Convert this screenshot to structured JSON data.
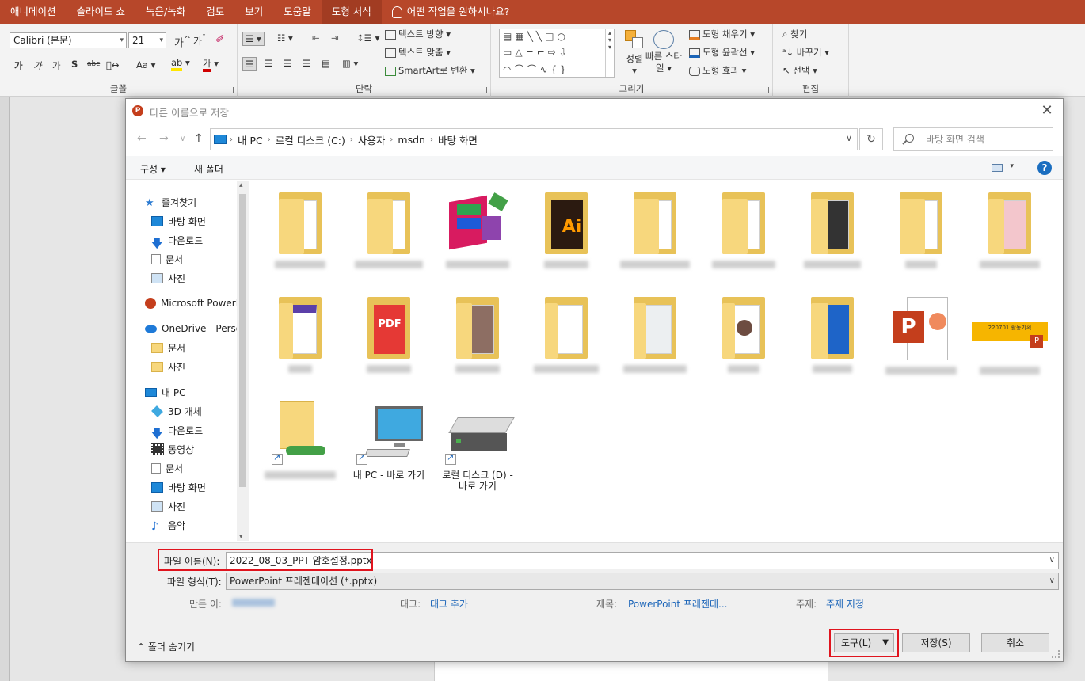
{
  "ribbon_tabs": [
    "애니메이션",
    "슬라이드 쇼",
    "녹음/녹화",
    "검토",
    "보기",
    "도움말",
    "도형 서식"
  ],
  "tell_me": "어떤 작업을 원하시나요?",
  "font": {
    "name": "Calibri (본문)",
    "size": "21",
    "group_label": "글꼴"
  },
  "paragraph": {
    "text_direction": "텍스트 방향",
    "align_text": "텍스트 맞춤",
    "smartart": "SmartArt로 변환",
    "group_label": "단락"
  },
  "drawing": {
    "arrange": "정렬",
    "quick_styles": "빠른 스타일",
    "shape_fill": "도형 채우기",
    "shape_outline": "도형 윤곽선",
    "shape_effects": "도형 효과",
    "group_label": "그리기"
  },
  "editing": {
    "find": "찾기",
    "replace": "바꾸기",
    "select": "선택",
    "group_label": "편집"
  },
  "dialog": {
    "title": "다른 이름으로 저장",
    "breadcrumbs": [
      "내 PC",
      "로컬 디스크 (C:)",
      "사용자",
      "msdn",
      "바탕 화면"
    ],
    "search_placeholder": "바탕 화면 검색",
    "organize": "구성",
    "new_folder": "새 폴더",
    "nav": {
      "quick_access": "즐겨찾기",
      "desktop": "바탕 화면",
      "downloads": "다운로드",
      "documents": "문서",
      "pictures": "사진",
      "powerpoint": "Microsoft PowerP",
      "onedrive": "OneDrive - Person",
      "od_documents": "문서",
      "od_pictures": "사진",
      "this_pc": "내 PC",
      "objects3d": "3D 개체",
      "pc_downloads": "다운로드",
      "videos": "동영상",
      "pc_documents": "문서",
      "pc_desktop": "바탕 화면",
      "pc_pictures": "사진",
      "music": "음악"
    },
    "files": {
      "mypc_shortcut": "내 PC - 바로 가기",
      "localdisk_shortcut": "로컬 디스크 (D) - 바로 가기",
      "banner_text": "220701 활동기획"
    },
    "form": {
      "filename_label": "파일 이름(N):",
      "filename_value": "2022_08_03_PPT 암호설정.pptx",
      "filetype_label": "파일 형식(T):",
      "filetype_value": "PowerPoint 프레젠테이션 (*.pptx)",
      "author_label": "만든 이:",
      "tags_label": "태그:",
      "tags_value": "태그 추가",
      "title_label": "제목:",
      "title_value": "PowerPoint 프레젠테...",
      "subject_label": "주제:",
      "subject_value": "주제 지정",
      "hide_folders": "폴더 숨기기",
      "tools": "도구(L)",
      "save": "저장(S)",
      "cancel": "취소"
    }
  },
  "colors": {
    "accent": "#b7472a",
    "highlight": "#e0141e",
    "link": "#1a64b8"
  }
}
